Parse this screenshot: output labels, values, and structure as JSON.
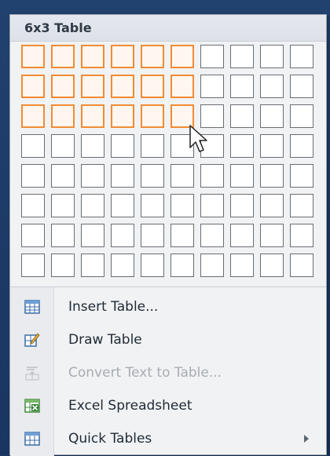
{
  "menu": {
    "title": "6x3 Table",
    "grid": {
      "columns": 10,
      "rows": 8,
      "selected_columns": 6,
      "selected_rows": 3
    },
    "items": [
      {
        "label": "Insert Table...",
        "icon": "insert-table-icon",
        "enabled": true
      },
      {
        "label": "Draw Table",
        "icon": "draw-table-icon",
        "enabled": true
      },
      {
        "label": "Convert Text to Table...",
        "icon": "convert-text-to-table-icon",
        "enabled": false
      },
      {
        "label": "Excel Spreadsheet",
        "icon": "excel-spreadsheet-icon",
        "enabled": true
      },
      {
        "label": "Quick Tables",
        "icon": "quick-tables-icon",
        "enabled": true,
        "submenu": true
      }
    ]
  },
  "colors": {
    "selection_border": "#f28b33",
    "cell_border": "#686e75",
    "menu_background": "#f1f2f3",
    "disabled_text": "#a7adb3"
  }
}
